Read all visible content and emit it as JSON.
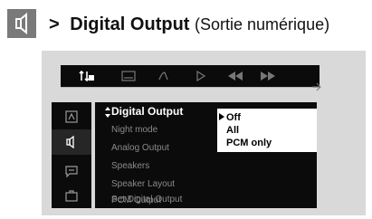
{
  "header": {
    "prefix": ">",
    "title": "Digital Output",
    "subtitle": "(Sortie numérique)",
    "icon": "speaker-icon"
  },
  "toolbar": {
    "icons": [
      "settings-icon",
      "subtitle-icon",
      "angle-icon",
      "play-icon",
      "rewind-icon",
      "fast-forward-icon"
    ]
  },
  "sidebar": {
    "icons": [
      "disc-icon",
      "speaker-icon",
      "subtitle-bubble-icon",
      "briefcase-icon"
    ],
    "selected": "speaker-icon"
  },
  "menu": {
    "items": [
      {
        "label": "Digital Output",
        "active": true
      },
      {
        "label": "Night mode"
      },
      {
        "label": "Analog Output"
      },
      {
        "label": "Speakers"
      },
      {
        "label": "Speaker Layout"
      },
      {
        "label": "PCM Output"
      },
      {
        "label": "Set Digital Output"
      }
    ]
  },
  "dropdown": {
    "options": [
      "Off",
      "All",
      "PCM only"
    ],
    "selected": "Off"
  }
}
